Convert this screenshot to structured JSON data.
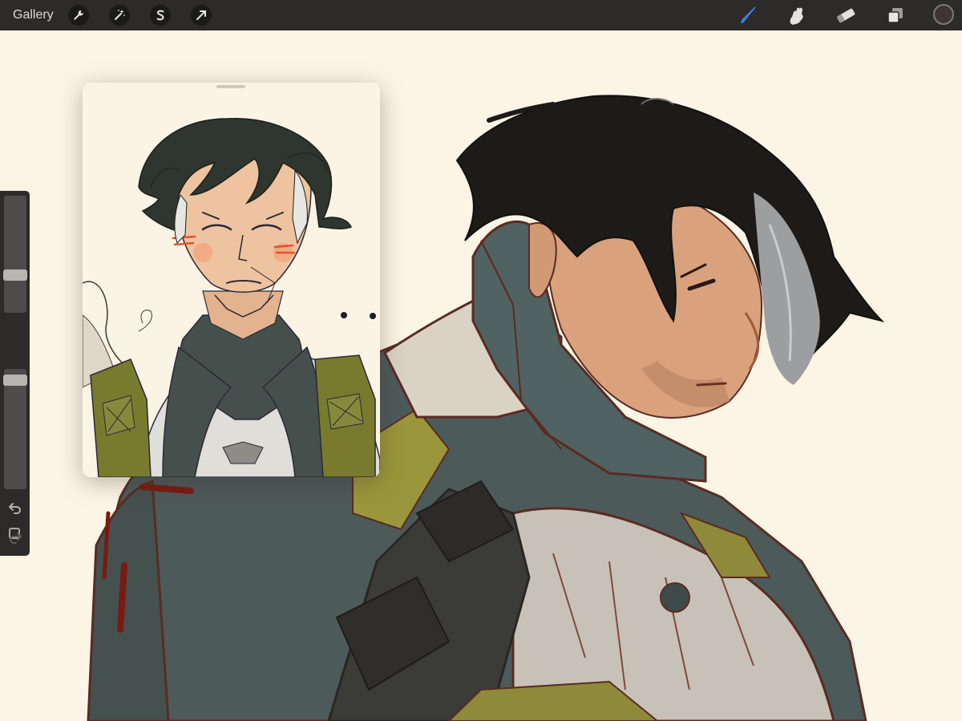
{
  "toolbar": {
    "gallery_label": "Gallery",
    "actions_icon": "wrench-icon",
    "adjustments_icon": "magic-wand-icon",
    "selection_icon": "selection-s-icon",
    "transform_icon": "transform-arrow-icon",
    "brush_icon": "brush-icon",
    "smudge_icon": "smudge-icon",
    "eraser_icon": "eraser-icon",
    "layers_icon": "layers-icon",
    "active_tool": "brush",
    "active_tool_color": "#3f82e6",
    "current_color": "#3d3434"
  },
  "sidebar": {
    "brush_size_level": 0.3,
    "brush_opacity_level": 0.95,
    "undo_icon": "undo-icon",
    "redo_icon": "redo-icon",
    "modify_icon": "square-icon"
  },
  "colors": {
    "canvas_bg": "#fcf5e6",
    "ui_bar": "#2c2b29"
  }
}
